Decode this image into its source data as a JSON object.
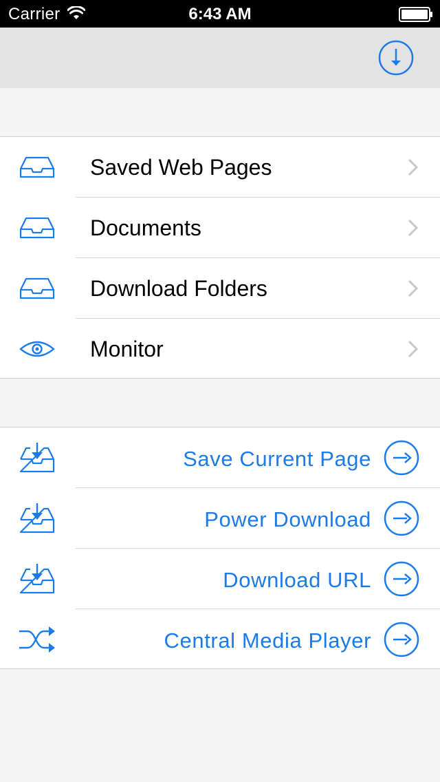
{
  "status_bar": {
    "carrier": "Carrier",
    "time": "6:43 AM"
  },
  "colors": {
    "accent": "#1b7bea",
    "chevron": "#c7c7cc",
    "nav_bg": "#e3e3e3",
    "page_bg": "#f4f4f4"
  },
  "nav": {
    "right_icon": "download-circle-icon"
  },
  "library": {
    "items": [
      {
        "label": "Saved Web Pages",
        "icon": "inbox-tray-icon"
      },
      {
        "label": "Documents",
        "icon": "inbox-tray-icon"
      },
      {
        "label": "Download Folders",
        "icon": "inbox-tray-icon"
      },
      {
        "label": "Monitor",
        "icon": "eye-icon"
      }
    ]
  },
  "actions": {
    "items": [
      {
        "label": "Save Current Page",
        "icon": "tray-download-icon"
      },
      {
        "label": "Power Download",
        "icon": "tray-download-icon"
      },
      {
        "label": "Download URL",
        "icon": "tray-download-icon"
      },
      {
        "label": "Central Media Player",
        "icon": "shuffle-icon"
      }
    ]
  }
}
